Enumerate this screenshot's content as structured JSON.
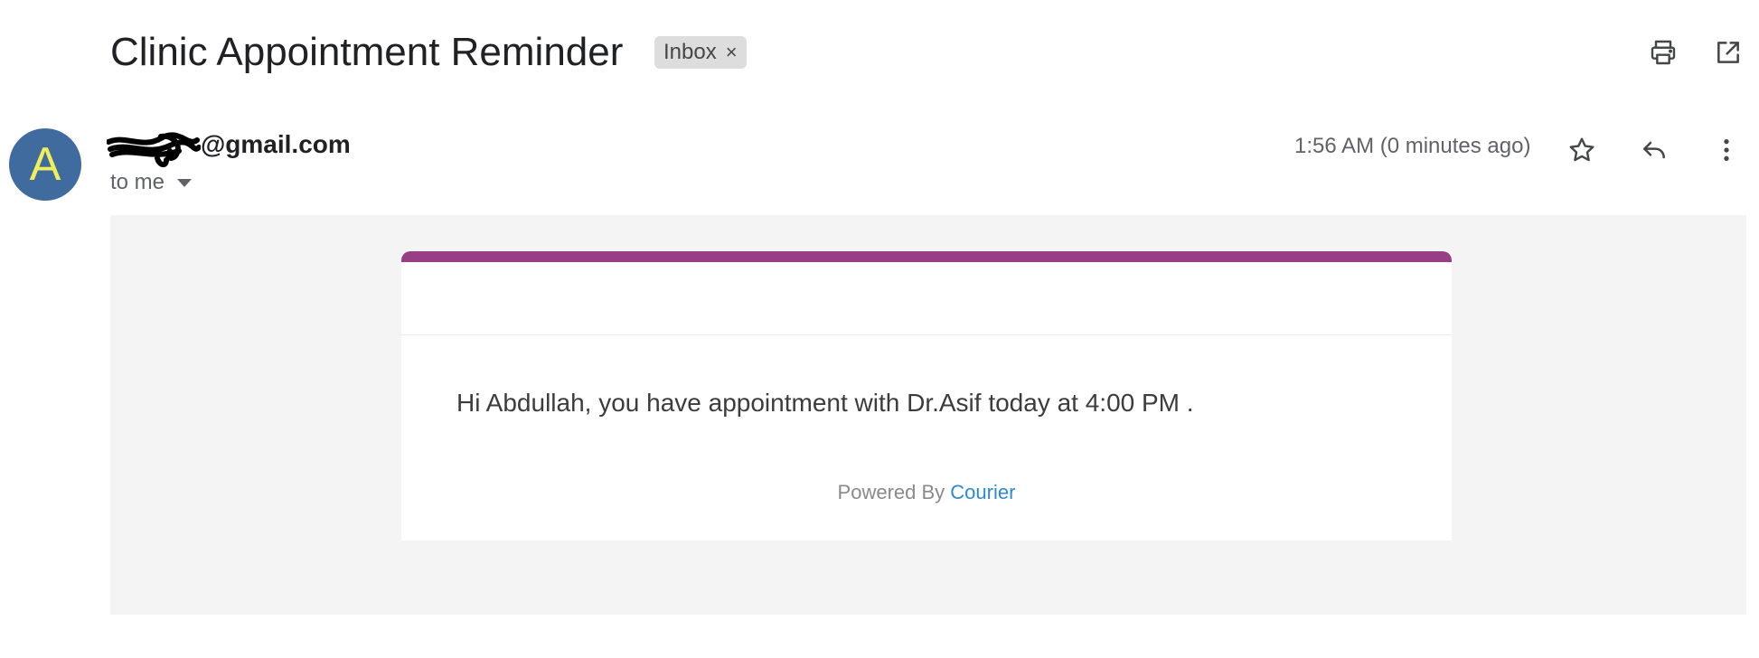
{
  "email": {
    "subject": "Clinic Appointment Reminder",
    "label": "Inbox",
    "label_remove_glyph": "×",
    "avatar_letter": "A",
    "sender_visible": "@gmail.com",
    "recipient": "to me",
    "timestamp": "1:56 AM (0 minutes ago)"
  },
  "icons": {
    "print": "print-icon",
    "open_new_window": "open-in-new-window-icon",
    "star": "star-icon",
    "reply": "reply-icon",
    "more": "more-vertical-icon"
  },
  "colors": {
    "accent_bar": "#983e86",
    "avatar_bg": "#3f6b9e",
    "avatar_letter": "#f2ee5b",
    "link": "#2c8ad6",
    "body_bg": "#f4f4f4"
  },
  "body": {
    "message": "Hi Abdullah, you have appointment with Dr.Asif today at 4:00 PM .",
    "powered_by": "Powered By",
    "powered_link": "Courier"
  }
}
